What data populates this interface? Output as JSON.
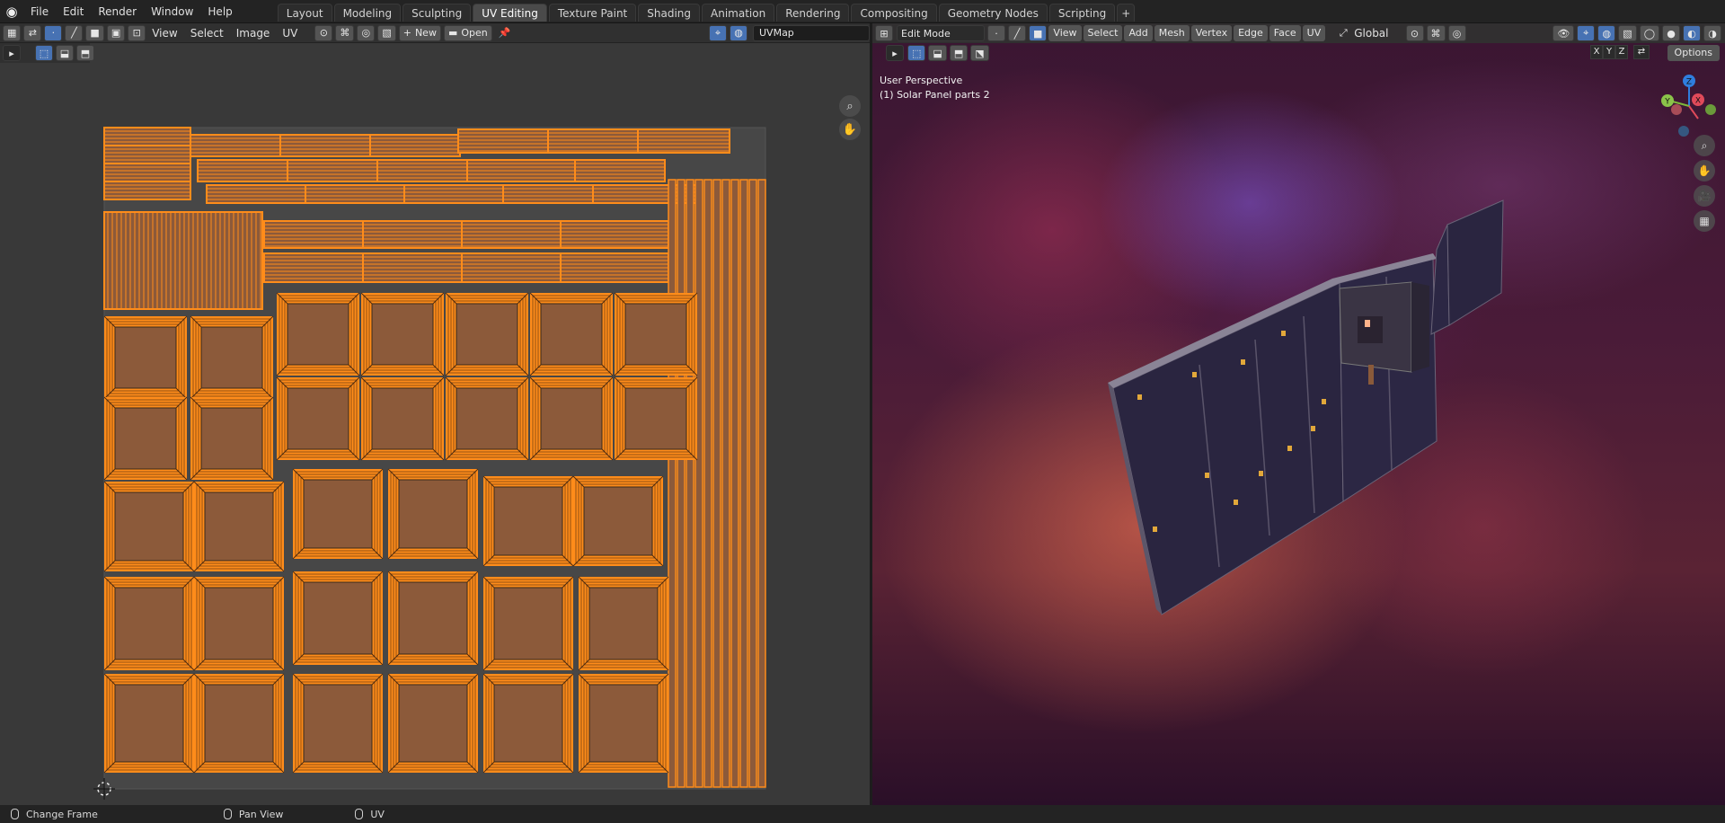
{
  "app": {
    "logo": "blender-logo-icon",
    "menu": [
      "File",
      "Edit",
      "Render",
      "Window",
      "Help"
    ],
    "workspace_tabs": [
      "Layout",
      "Modeling",
      "Sculpting",
      "UV Editing",
      "Texture Paint",
      "Shading",
      "Animation",
      "Rendering",
      "Compositing",
      "Geometry Nodes",
      "Scripting"
    ],
    "active_tab": "UV Editing",
    "add_tab": "+"
  },
  "uv_editor": {
    "menus": [
      "View",
      "Select",
      "Image",
      "UV"
    ],
    "new_label": "New",
    "open_label": "Open",
    "uv_map": "UVMap",
    "zoom_icon": "zoom-icon",
    "pan_icon": "hand-pan-icon",
    "island_fill": "#8c5a3a",
    "edge_color": "#ff8c1a"
  },
  "viewport": {
    "mode": "Edit Mode",
    "menus": [
      "View",
      "Select",
      "Add",
      "Mesh",
      "Vertex",
      "Edge",
      "Face",
      "UV"
    ],
    "orientation": "Global",
    "perspective_label": "User Perspective",
    "object_label": "(1) Solar Panel parts 2",
    "axis_buttons": [
      "X",
      "Y",
      "Z"
    ],
    "options_label": "Options",
    "gizmo": {
      "z": "Z",
      "y": "Y",
      "x": "X"
    }
  },
  "status": {
    "items": [
      "Change Frame",
      "Pan View",
      "UV"
    ]
  }
}
